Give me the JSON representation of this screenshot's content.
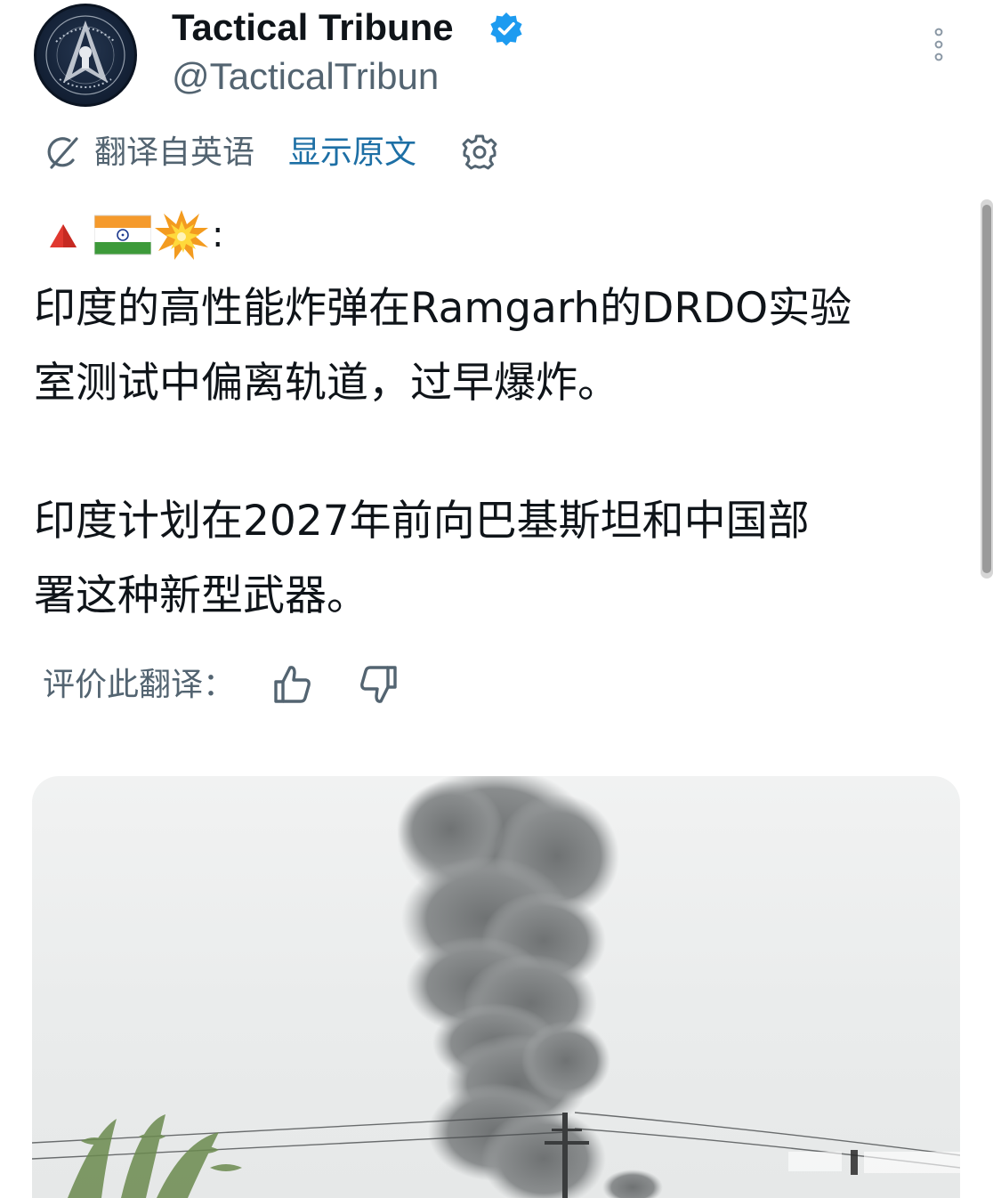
{
  "account": {
    "name": "Tactical Tribune",
    "handle": "@TacticalTribun",
    "verified": true,
    "avatar_text": "Tactical Tribune"
  },
  "translation": {
    "label": "翻译自英语",
    "show_original": "显示原文"
  },
  "tweet": {
    "emoji_prefix": [
      "red-triangle-icon",
      "india-flag-icon",
      "collision-icon"
    ],
    "emoji_suffix": ":",
    "paragraph1": [
      "印度的高性能炸弹在Ramgarh的DRDO实验",
      "室测试中偏离轨道，过早爆炸。"
    ],
    "paragraph2": [
      "印度计划在2027年前向巴基斯坦和中国部",
      "署这种新型武器。"
    ]
  },
  "rating": {
    "label": "评价此翻译："
  },
  "colors": {
    "link": "#1d6fa5",
    "secondary_text": "#536471",
    "verified_badge": "#1d9bf0"
  }
}
